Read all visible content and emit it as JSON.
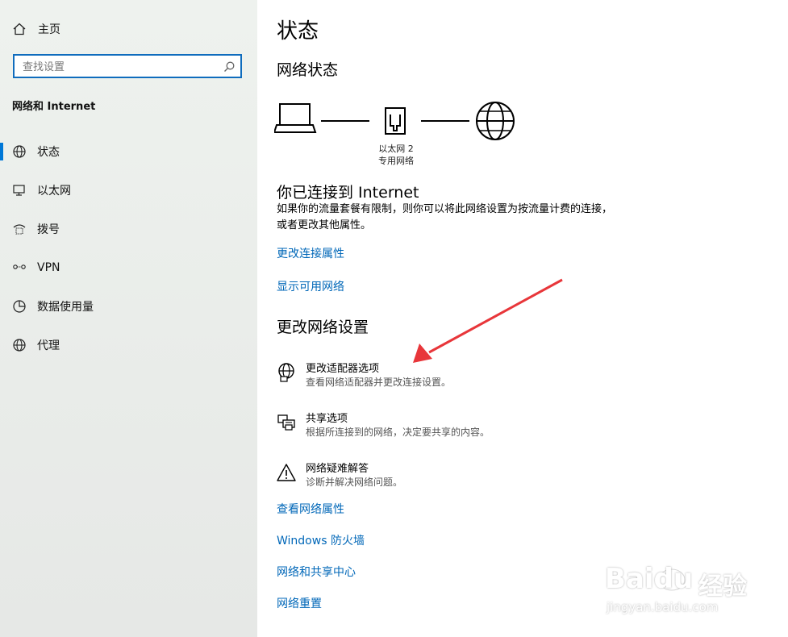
{
  "sidebar": {
    "home_label": "主页",
    "search_placeholder": "查找设置",
    "section_title": "网络和 Internet",
    "items": [
      {
        "label": "状态",
        "icon": "globe-status-icon"
      },
      {
        "label": "以太网",
        "icon": "ethernet-icon"
      },
      {
        "label": "拨号",
        "icon": "dialup-icon"
      },
      {
        "label": "VPN",
        "icon": "vpn-icon"
      },
      {
        "label": "数据使用量",
        "icon": "data-usage-icon"
      },
      {
        "label": "代理",
        "icon": "globe-proxy-icon"
      }
    ],
    "selected_index": 0,
    "accent_color": "#0078d7"
  },
  "main": {
    "title": "状态",
    "network_status_heading": "网络状态",
    "diagram": {
      "adapter_name": "以太网 2",
      "network_type": "专用网络"
    },
    "connected_heading": "你已连接到 Internet",
    "connected_description": "如果你的流量套餐有限制，则你可以将此网络设置为按流量计费的连接，或者更改其他属性。",
    "links_top": [
      "更改连接属性",
      "显示可用网络"
    ],
    "change_settings_heading": "更改网络设置",
    "options": [
      {
        "title": "更改适配器选项",
        "subtitle": "查看网络适配器并更改连接设置。",
        "icon": "adapter-globe-icon"
      },
      {
        "title": "共享选项",
        "subtitle": "根据所连接到的网络，决定要共享的内容。",
        "icon": "sharing-printer-icon"
      },
      {
        "title": "网络疑难解答",
        "subtitle": "诊断并解决网络问题。",
        "icon": "warning-icon"
      }
    ],
    "links_bottom": [
      "查看网络属性",
      "Windows 防火墙",
      "网络和共享中心",
      "网络重置"
    ],
    "link_color": "#0067b8"
  },
  "annotation": {
    "arrow_color": "#e8363a"
  },
  "watermark": {
    "brand": "Baidu",
    "brand_cn": "经验",
    "url": "jingyan.baidu.com"
  }
}
